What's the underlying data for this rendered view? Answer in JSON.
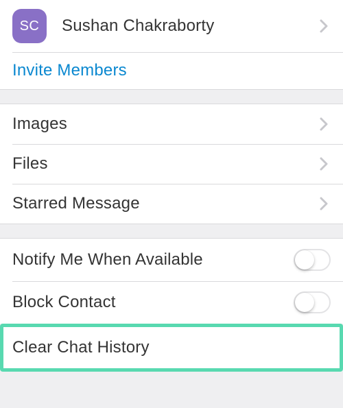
{
  "contact": {
    "initials": "SC",
    "name": "Sushan Chakraborty"
  },
  "invite": {
    "label": "Invite Members"
  },
  "media": {
    "images": "Images",
    "files": "Files",
    "starred": "Starred Message"
  },
  "settings": {
    "notify": {
      "label": "Notify Me When Available",
      "on": false
    },
    "block": {
      "label": "Block Contact",
      "on": false
    },
    "clear": {
      "label": "Clear Chat History"
    }
  }
}
